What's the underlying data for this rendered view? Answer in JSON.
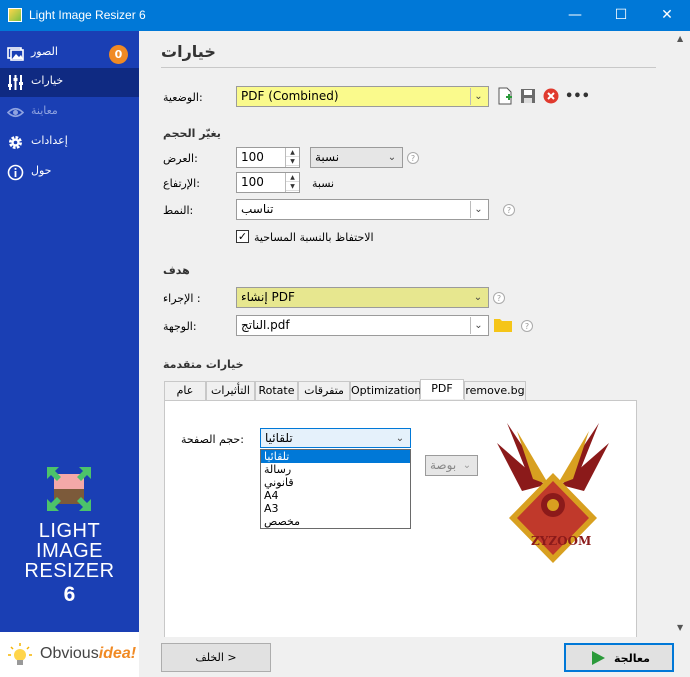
{
  "window": {
    "title": "Light Image Resizer 6",
    "minimize": "—",
    "maximize": "☐",
    "close": "✕"
  },
  "sidebar": {
    "badge": "0",
    "items": [
      {
        "label": "الصور",
        "icon": "images-icon"
      },
      {
        "label": "خيارات",
        "icon": "sliders-icon"
      },
      {
        "label": "معاينة",
        "icon": "eye-icon"
      },
      {
        "label": "إعدادات",
        "icon": "gear-icon"
      },
      {
        "label": "حول",
        "icon": "info-icon"
      }
    ],
    "logo_line1": "LIGHT",
    "logo_line2": "IMAGE",
    "logo_line3": "RESIZER",
    "logo_number": "6",
    "brand_text": "Obvious",
    "brand_idea": "idea!"
  },
  "main": {
    "title": "خيارات",
    "profile": {
      "label": "الوضعية:",
      "value": "PDF (Combined)",
      "more": "•••"
    },
    "resize": {
      "section": "يغيّر الحجم",
      "width_label": "العرض:",
      "width_value": "100",
      "height_label": "الإرتفاع:",
      "height_value": "100",
      "unit_select": "نسبة",
      "unit_text": "نسبة",
      "mode_label": "النمط:",
      "mode_value": "تناسب",
      "keep_area_label": "الاحتفاظ بالنسبة المساحية",
      "keep_area_checked": "✓"
    },
    "target": {
      "section": "هدف",
      "action_label": "الإجراء :",
      "action_value": "إنشاء PDF",
      "dest_label": "الوجهة:",
      "dest_value": "الناتج.pdf"
    },
    "advanced": {
      "section": "خيارات متقدمة",
      "tabs": [
        "عام",
        "التأثيرات",
        "Rotate",
        "متفرقات",
        "Optimization",
        "PDF",
        "remove.bg"
      ],
      "page_size_label": "حجم الصفحة:",
      "page_size_value": "تلقائيا",
      "page_size_options": [
        "تلقائيا",
        "رسالة",
        "قانوني",
        "A4",
        "A3",
        "مخصص"
      ],
      "unit_value": "بوصة",
      "watermark_text": "ZYZOOM"
    },
    "buttons": {
      "back": "الخلف >",
      "process": "معالجة"
    }
  }
}
